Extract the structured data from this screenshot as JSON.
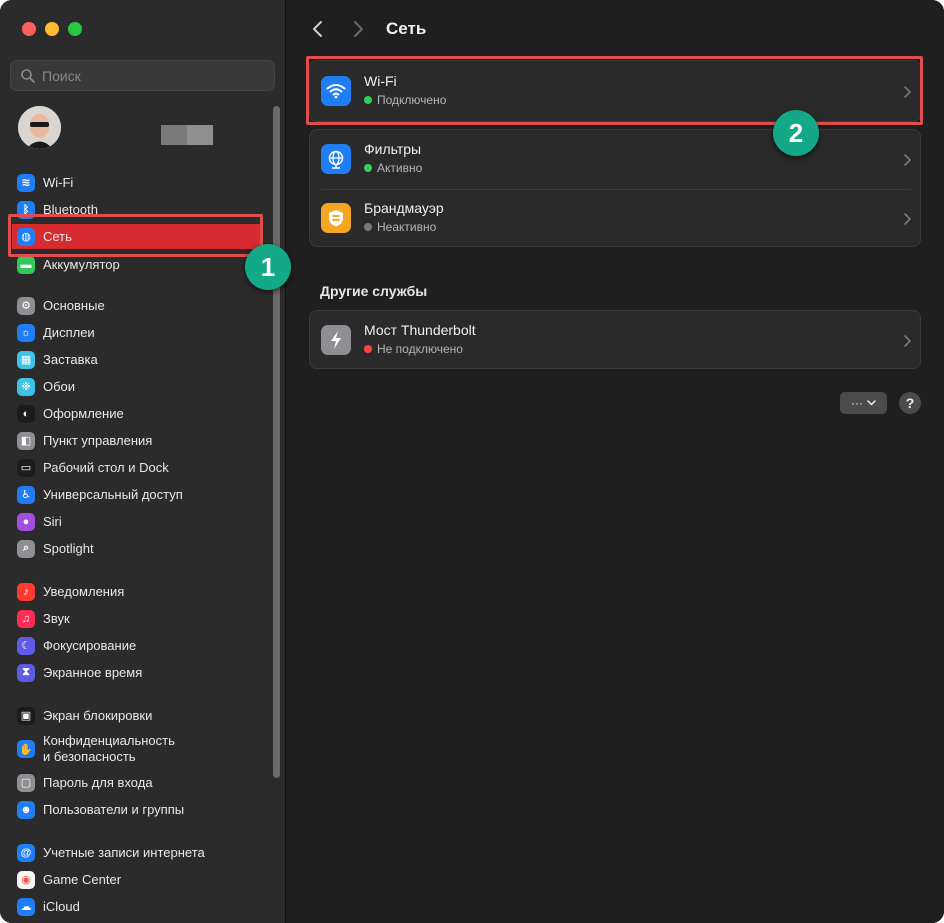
{
  "search": {
    "placeholder": "Поиск"
  },
  "page": {
    "title": "Сеть"
  },
  "sidebar": {
    "items": [
      {
        "label": "Wi-Fi",
        "icon": "wifi-icon",
        "color": "#1f7ef5"
      },
      {
        "label": "Bluetooth",
        "icon": "bluetooth-icon",
        "color": "#1f7ef5"
      },
      {
        "label": "Сеть",
        "icon": "globe-icon",
        "color": "#1f7ef5",
        "selected": true
      },
      {
        "label": "Аккумулятор",
        "icon": "battery-icon",
        "color": "#34c759"
      },
      {
        "label": "Основные",
        "icon": "gear-icon",
        "color": "#8e8e93"
      },
      {
        "label": "Дисплеи",
        "icon": "display-icon",
        "color": "#1f7ef5"
      },
      {
        "label": "Заставка",
        "icon": "screensaver-icon",
        "color": "#3ec3e8"
      },
      {
        "label": "Обои",
        "icon": "wallpaper-icon",
        "color": "#3ec3e8"
      },
      {
        "label": "Оформление",
        "icon": "appearance-icon",
        "color": "#1c1c1c"
      },
      {
        "label": "Пункт управления",
        "icon": "control-center-icon",
        "color": "#8e8e93"
      },
      {
        "label": "Рабочий стол и Dock",
        "icon": "dock-icon",
        "color": "#1c1c1c"
      },
      {
        "label": "Универсальный доступ",
        "icon": "accessibility-icon",
        "color": "#1f7ef5"
      },
      {
        "label": "Siri",
        "icon": "siri-icon",
        "color": "#a34ee0"
      },
      {
        "label": "Spotlight",
        "icon": "spotlight-icon",
        "color": "#8e8e93"
      },
      {
        "label": "Уведомления",
        "icon": "bell-icon",
        "color": "#ff3b30"
      },
      {
        "label": "Звук",
        "icon": "speaker-icon",
        "color": "#ff2d55"
      },
      {
        "label": "Фокусирование",
        "icon": "moon-icon",
        "color": "#5e5ce6"
      },
      {
        "label": "Экранное время",
        "icon": "hourglass-icon",
        "color": "#5e5ce6"
      },
      {
        "label": "Экран блокировки",
        "icon": "lock-screen-icon",
        "color": "#1c1c1c"
      },
      {
        "label": "Конфиденциальность",
        "label2": "и безопасность",
        "icon": "hand-icon",
        "color": "#1f7ef5"
      },
      {
        "label": "Пароль для входа",
        "icon": "lock-icon",
        "color": "#8e8e93"
      },
      {
        "label": "Пользователи и группы",
        "icon": "users-icon",
        "color": "#1f7ef5"
      },
      {
        "label": "Учетные записи интернета",
        "icon": "at-icon",
        "color": "#1f7ef5"
      },
      {
        "label": "Game Center",
        "icon": "game-center-icon",
        "color": "#f5f5f5"
      },
      {
        "label": "iCloud",
        "icon": "cloud-icon",
        "color": "#1f7ef5"
      }
    ]
  },
  "services": [
    {
      "title": "Wi-Fi",
      "status": "Подключено",
      "status_color": "#30d158",
      "icon": "wifi-icon",
      "icon_color": "#1f7ef5"
    },
    {
      "title": "Фильтры",
      "status": "Активно",
      "status_color": "#30d158",
      "icon": "globe-icon",
      "icon_color": "#1f7ef5"
    },
    {
      "title": "Брандмауэр",
      "status": "Неактивно",
      "status_color": "#7a7a7a",
      "icon": "firewall-icon",
      "icon_color": "#f5a623"
    }
  ],
  "other_services": {
    "title": "Другие службы",
    "items": [
      {
        "title": "Мост Thunderbolt",
        "status": "Не подключено",
        "status_color": "#ff453a",
        "icon": "thunderbolt-icon",
        "icon_color": "#8e8e93"
      }
    ]
  },
  "actions": {
    "more_label": "···",
    "help_label": "?"
  },
  "annotations": {
    "badge1": "1",
    "badge2": "2",
    "highlight_color": "#e14d4d",
    "badge_color": "#13a887"
  }
}
